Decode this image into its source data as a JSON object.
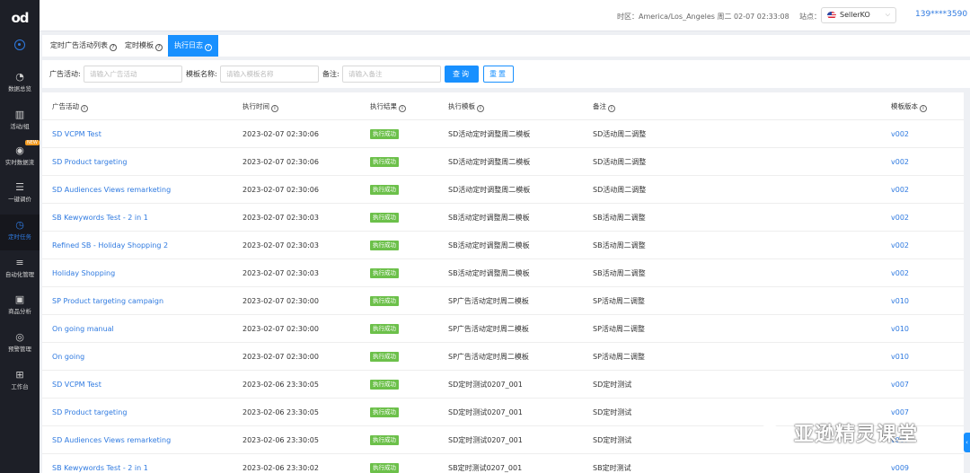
{
  "sidebar": {
    "logo": "od",
    "items": [
      {
        "label": "数据总览",
        "icon": "pie-chart-icon"
      },
      {
        "label": "活动/组",
        "icon": "bar-chart-icon"
      },
      {
        "label": "实时数据流",
        "icon": "realtime-icon",
        "badge": "NEW"
      },
      {
        "label": "一键调价",
        "icon": "adjust-icon"
      },
      {
        "label": "定时任务",
        "icon": "clock-icon",
        "active": true
      },
      {
        "label": "自动化管理",
        "icon": "sliders-icon"
      },
      {
        "label": "商品分析",
        "icon": "product-icon"
      },
      {
        "label": "预警管理",
        "icon": "alert-icon"
      },
      {
        "label": "工作台",
        "icon": "grid-icon"
      }
    ]
  },
  "topbar": {
    "timezone_text": "时区：America/Los_Angeles 周二 02-07 02:33:08",
    "site_label": "站点：",
    "site_value": "SellerKO",
    "account": "139****3590"
  },
  "tabs": [
    {
      "label": "定时广告活动列表"
    },
    {
      "label": "定时模板"
    },
    {
      "label": "执行日志",
      "active": true
    }
  ],
  "filters": {
    "campaign_label": "广告活动:",
    "campaign_placeholder": "请输入广告活动",
    "template_label": "模板名称:",
    "template_placeholder": "请输入模板名称",
    "remark_label": "备注:",
    "remark_placeholder": "请输入备注",
    "search_button": "查询",
    "reset_button": "重置"
  },
  "table": {
    "columns": [
      "广告活动",
      "执行时间",
      "执行结果",
      "执行模板",
      "备注",
      "模板版本"
    ],
    "rows": [
      {
        "campaign": "SD VCPM Test",
        "time": "2023-02-07 02:30:06",
        "result": "执行成功",
        "template": "SD活动定时调整周二模板",
        "remark": "SD活动周二调整",
        "version": "v002"
      },
      {
        "campaign": "SD Product targeting",
        "time": "2023-02-07 02:30:06",
        "result": "执行成功",
        "template": "SD活动定时调整周二模板",
        "remark": "SD活动周二调整",
        "version": "v002"
      },
      {
        "campaign": "SD Audiences Views remarketing",
        "time": "2023-02-07 02:30:06",
        "result": "执行成功",
        "template": "SD活动定时调整周二模板",
        "remark": "SD活动周二调整",
        "version": "v002"
      },
      {
        "campaign": "SB Kewywords Test - 2 in 1",
        "time": "2023-02-07 02:30:03",
        "result": "执行成功",
        "template": "SB活动定时调整周二模板",
        "remark": "SB活动周二调整",
        "version": "v002"
      },
      {
        "campaign": "Refined SB - Holiday Shopping 2",
        "time": "2023-02-07 02:30:03",
        "result": "执行成功",
        "template": "SB活动定时调整周二模板",
        "remark": "SB活动周二调整",
        "version": "v002"
      },
      {
        "campaign": "Holiday Shopping",
        "time": "2023-02-07 02:30:03",
        "result": "执行成功",
        "template": "SB活动定时调整周二模板",
        "remark": "SB活动周二调整",
        "version": "v002"
      },
      {
        "campaign": "SP Product targeting campaign",
        "time": "2023-02-07 02:30:00",
        "result": "执行成功",
        "template": "SP广告活动定时周二模板",
        "remark": "SP活动周二调整",
        "version": "v010"
      },
      {
        "campaign": "On going manual",
        "time": "2023-02-07 02:30:00",
        "result": "执行成功",
        "template": "SP广告活动定时周二模板",
        "remark": "SP活动周二调整",
        "version": "v010"
      },
      {
        "campaign": "On going",
        "time": "2023-02-07 02:30:00",
        "result": "执行成功",
        "template": "SP广告活动定时周二模板",
        "remark": "SP活动周二调整",
        "version": "v010"
      },
      {
        "campaign": "SD VCPM Test",
        "time": "2023-02-06 23:30:05",
        "result": "执行成功",
        "template": "SD定时测试0207_001",
        "remark": "SD定时测试",
        "version": "v007"
      },
      {
        "campaign": "SD Product targeting",
        "time": "2023-02-06 23:30:05",
        "result": "执行成功",
        "template": "SD定时测试0207_001",
        "remark": "SD定时测试",
        "version": "v007"
      },
      {
        "campaign": "SD Audiences Views remarketing",
        "time": "2023-02-06 23:30:05",
        "result": "执行成功",
        "template": "SD定时测试0207_001",
        "remark": "SD定时测试",
        "version": "v007"
      },
      {
        "campaign": "SB Kewywords Test - 2 in 1",
        "time": "2023-02-06 23:30:02",
        "result": "执行成功",
        "template": "SB定时测试0207_001",
        "remark": "SB定时测试",
        "version": "v009"
      }
    ]
  },
  "watermark": "亚逊精灵课堂",
  "colors": {
    "accent": "#1890ff",
    "link": "#2f7ae0",
    "success": "#6cc04a",
    "sidebar": "#1d1f27"
  }
}
